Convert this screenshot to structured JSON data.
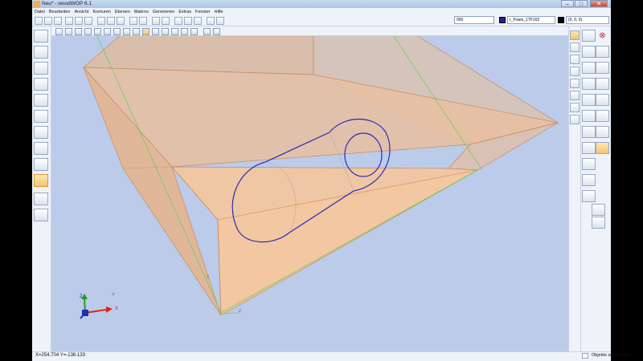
{
  "window": {
    "title": "Neu* - woodWOP 6.1",
    "min": "–",
    "max": "□",
    "close": "✕"
  },
  "menu": [
    "Datei",
    "Bearbeiten",
    "Ansicht",
    "Konturen",
    "Ebenen",
    "Makros",
    "Generieren",
    "Extras",
    "Fenster",
    "Hilfe"
  ],
  "toolbar": {
    "layer_value": "000",
    "tool_value": "r_Fraes_1TF102",
    "coord_value": "(0, 0, 0)"
  },
  "statusbar": {
    "coords": "X=254.704 Y=-136.133",
    "mode": "Objekte selektieren"
  },
  "viewport": {
    "background": "#bccbe9",
    "panel_fill": "#f2c497",
    "edge_color": "#c17a4c",
    "contour_color": "#2a2ab8",
    "guide_color": "#64d05a",
    "axis_labels": {
      "x": "X",
      "y": "Y",
      "z": "Z"
    }
  }
}
